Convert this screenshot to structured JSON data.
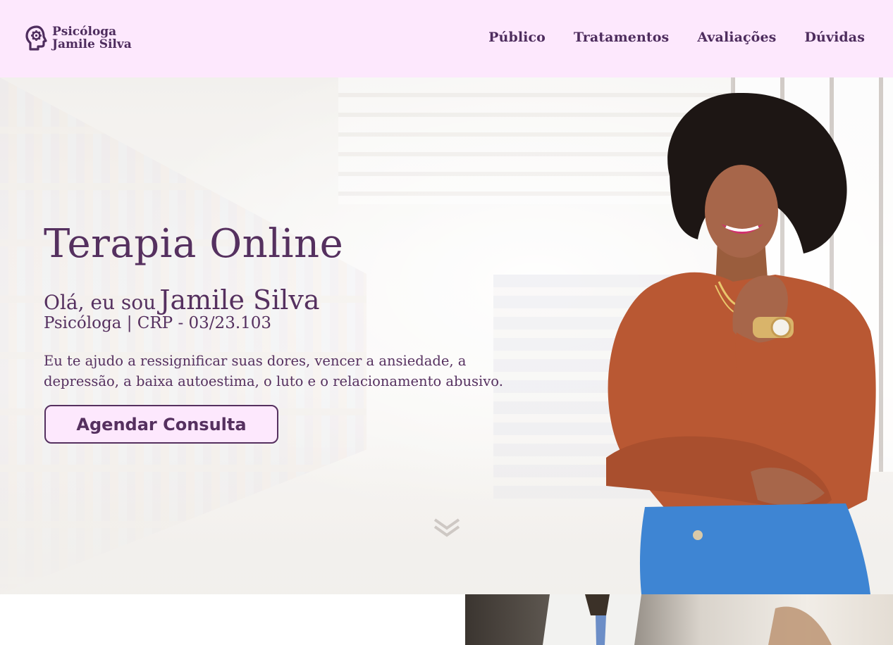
{
  "header": {
    "logo": {
      "line1": "Psicóloga",
      "line2": "Jamile Silva",
      "icon": "head-gear-icon"
    },
    "nav": [
      "Público",
      "Tratamentos",
      "Avaliações",
      "Dúvidas"
    ]
  },
  "hero": {
    "title": "Terapia Online",
    "greeting_prefix": "Olá, eu sou",
    "name": "Jamile Silva",
    "subtitle": "Psicóloga | CRP - 03/23.103",
    "description": "Eu te ajudo a ressignificar suas dores, vencer a ansiedade, a depressão, a baixa autoestima, o luto e o relacionamento abusivo.",
    "cta_label": "Agendar Consulta",
    "scroll_icon": "double-chevron-down-icon"
  },
  "colors": {
    "brand": "#55305f",
    "header_bg": "#fde8fd"
  }
}
